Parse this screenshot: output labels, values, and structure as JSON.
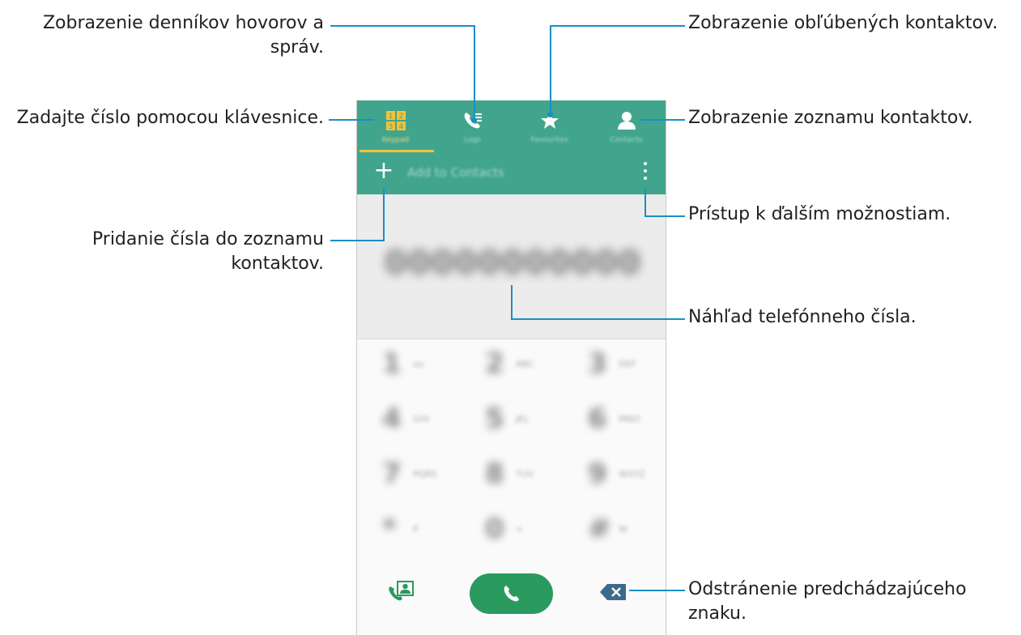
{
  "annotations": {
    "logs": "Zobrazenie denníkov hovorov a\nspráv.",
    "favourites": "Zobrazenie obľúbených kontaktov.",
    "keypad": "Zadajte číslo pomocou klávesnice.",
    "contacts": "Zobrazenie zoznamu kontaktov.",
    "more_options": "Prístup k ďalším možnostiam.",
    "add_number": "Pridanie čísla do zoznamu\nkontaktov.",
    "preview": "Náhľad telefónneho čísla.",
    "delete": "Odstránenie predchádzajúceho\nznaku."
  },
  "phone": {
    "tabs": [
      {
        "label": "Keypad",
        "icon": "dialpad-icon",
        "active": true
      },
      {
        "label": "Logs",
        "icon": "call-log-icon",
        "active": false
      },
      {
        "label": "Favourites",
        "icon": "star-icon",
        "active": false
      },
      {
        "label": "Contacts",
        "icon": "person-icon",
        "active": false
      }
    ],
    "action_bar": {
      "add_label": "Add to Contacts",
      "add_icon": "plus-icon",
      "more_icon": "more-vert-icon"
    },
    "number_display": "00000000000",
    "keys": [
      {
        "digit": "1",
        "letters": "oo"
      },
      {
        "digit": "2",
        "letters": "ABC"
      },
      {
        "digit": "3",
        "letters": "DEF"
      },
      {
        "digit": "4",
        "letters": "GHI"
      },
      {
        "digit": "5",
        "letters": "JKL"
      },
      {
        "digit": "6",
        "letters": "MNO"
      },
      {
        "digit": "7",
        "letters": "PQRS"
      },
      {
        "digit": "8",
        "letters": "TUV"
      },
      {
        "digit": "9",
        "letters": "WXYZ"
      },
      {
        "digit": "*",
        "letters": "P"
      },
      {
        "digit": "0",
        "letters": "+"
      },
      {
        "digit": "#",
        "letters": "W"
      }
    ],
    "bottom": {
      "contact_icon": "contact-card-icon",
      "call_icon": "phone-icon",
      "delete_icon": "backspace-icon"
    },
    "colors": {
      "primary": "#41a58d",
      "tab_indicator": "#f3c13a",
      "call": "#2b9a5f",
      "leader_line": "#1a8fc6"
    }
  }
}
